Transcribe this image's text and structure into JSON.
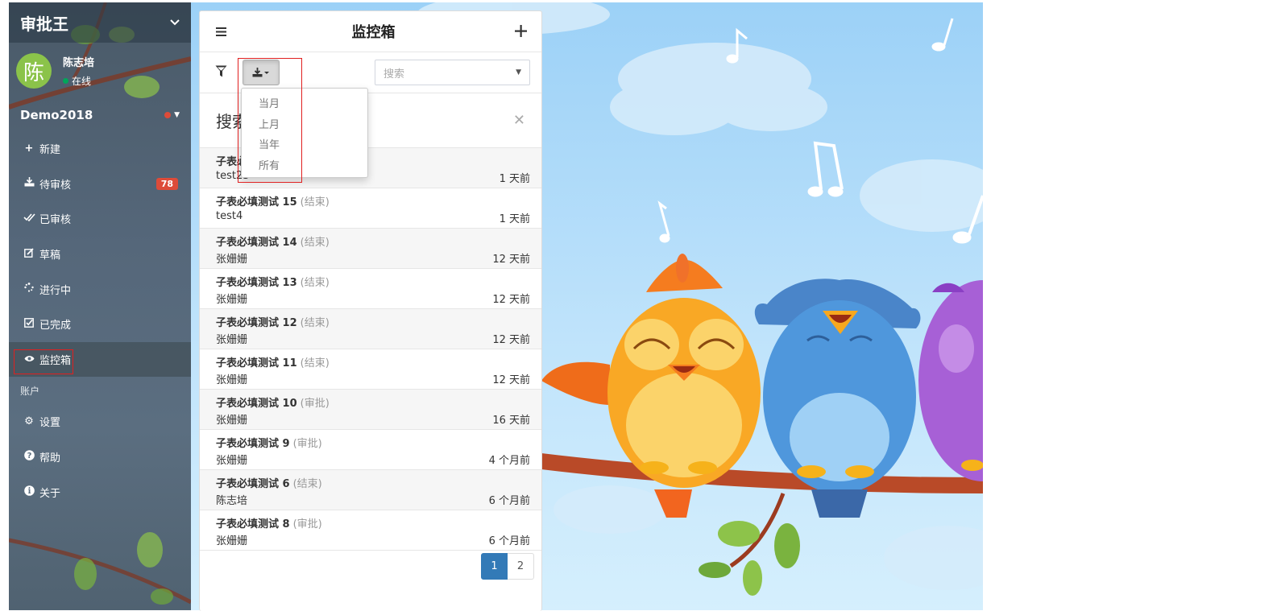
{
  "app": {
    "title": "审批王"
  },
  "user": {
    "avatar_char": "陈",
    "name": "陈志培",
    "status": "在线"
  },
  "org": {
    "name": "Demo2018"
  },
  "menu": {
    "items": [
      {
        "label": "新建",
        "icon": "plus-icon"
      },
      {
        "label": "待审核",
        "icon": "inbox-download-icon",
        "badge": "78"
      },
      {
        "label": "已审核",
        "icon": "double-check-icon"
      },
      {
        "label": "草稿",
        "icon": "edit-icon"
      },
      {
        "label": "进行中",
        "icon": "spinner-icon"
      },
      {
        "label": "已完成",
        "icon": "check-square-icon"
      },
      {
        "label": "监控箱",
        "icon": "eye-icon"
      }
    ],
    "account_header": "账户",
    "account_items": [
      {
        "label": "设置",
        "icon": "gear-icon"
      },
      {
        "label": "帮助",
        "icon": "question-circle-icon"
      },
      {
        "label": "关于",
        "icon": "info-circle-icon"
      }
    ]
  },
  "panel": {
    "title": "监控箱",
    "search_placeholder": "搜索",
    "search_box_label": "搜索",
    "dropdown_options": [
      "当月",
      "上月",
      "当年",
      "所有"
    ],
    "rows": [
      {
        "title": "子表必",
        "status": "",
        "sub": "test23",
        "time": "1 天前"
      },
      {
        "title": "子表必填测试 15",
        "status": "(结束)",
        "sub": "test4",
        "time": "1 天前"
      },
      {
        "title": "子表必填测试 14",
        "status": "(结束)",
        "sub": "张姗姗",
        "time": "12 天前"
      },
      {
        "title": "子表必填测试 13",
        "status": "(结束)",
        "sub": "张姗姗",
        "time": "12 天前"
      },
      {
        "title": "子表必填测试 12",
        "status": "(结束)",
        "sub": "张姗姗",
        "time": "12 天前"
      },
      {
        "title": "子表必填测试 11",
        "status": "(结束)",
        "sub": "张姗姗",
        "time": "12 天前"
      },
      {
        "title": "子表必填测试 10",
        "status": "(审批)",
        "sub": "张姗姗",
        "time": "16 天前"
      },
      {
        "title": "子表必填测试 9",
        "status": "(审批)",
        "sub": "张姗姗",
        "time": "4 个月前"
      },
      {
        "title": "子表必填测试 6",
        "status": "(结束)",
        "sub": "陈志培",
        "time": "6 个月前"
      },
      {
        "title": "子表必填测试 8",
        "status": "(审批)",
        "sub": "张姗姗",
        "time": "6 个月前"
      }
    ],
    "pages": [
      "1",
      "2"
    ]
  },
  "colors": {
    "accent": "#337ab7",
    "badge": "#dd4b39",
    "online": "#00a65a",
    "avatar": "#8bc34a"
  }
}
